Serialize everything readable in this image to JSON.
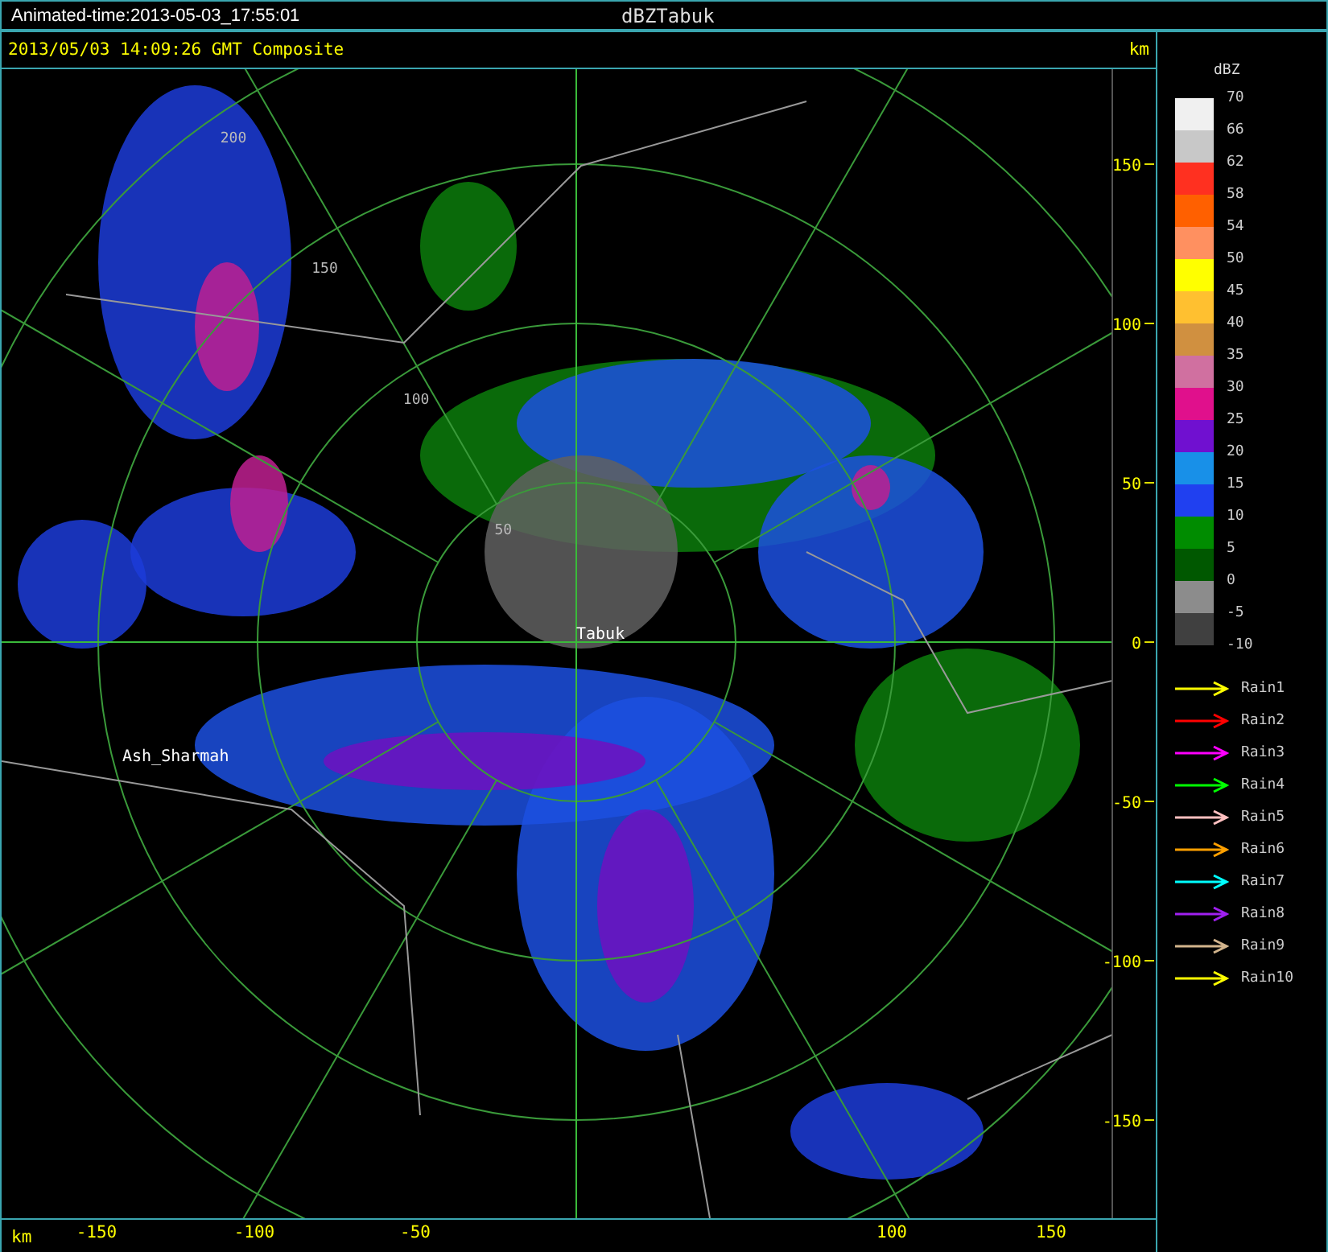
{
  "title_bar": {
    "animated_time": "Animated-time:2013-05-03_17:55:01",
    "title": "dBZTabuk"
  },
  "header": {
    "caption": "2013/05/03 14:09:26 GMT Composite",
    "unit": "km"
  },
  "map": {
    "ring_labels": [
      "50",
      "100",
      "150",
      "200"
    ],
    "places": [
      {
        "name": "Tabuk"
      },
      {
        "name": "Ash_Sharmah"
      }
    ]
  },
  "y_axis": {
    "ticks": [
      "150",
      "100",
      "50",
      "0",
      "-50",
      "-100",
      "-150"
    ]
  },
  "x_axis": {
    "unit": "km",
    "ticks": [
      "-150",
      "-100",
      "-50",
      "100",
      "150"
    ]
  },
  "legend": {
    "title": "dBZ",
    "scale": [
      {
        "label": "70",
        "color": "#f0f0f0"
      },
      {
        "label": "66",
        "color": "#c8c8c8"
      },
      {
        "label": "62",
        "color": "#ff3020"
      },
      {
        "label": "58",
        "color": "#ff6000"
      },
      {
        "label": "54",
        "color": "#ff9060"
      },
      {
        "label": "50",
        "color": "#ffff00"
      },
      {
        "label": "45",
        "color": "#ffc030"
      },
      {
        "label": "40",
        "color": "#d09040"
      },
      {
        "label": "35",
        "color": "#d070a0"
      },
      {
        "label": "30",
        "color": "#e0108c"
      },
      {
        "label": "25",
        "color": "#7010d0"
      },
      {
        "label": "20",
        "color": "#1890e8"
      },
      {
        "label": "15",
        "color": "#2040f0"
      },
      {
        "label": "10",
        "color": "#008c00"
      },
      {
        "label": "5",
        "color": "#005800"
      },
      {
        "label": "0",
        "color": "#8c8c8c"
      },
      {
        "label": "-5",
        "color": "#404040"
      },
      {
        "label": "-10"
      }
    ],
    "tracks": [
      {
        "label": "Rain1",
        "color": "#ffff00"
      },
      {
        "label": "Rain2",
        "color": "#ff0000"
      },
      {
        "label": "Rain3",
        "color": "#ff00ff"
      },
      {
        "label": "Rain4",
        "color": "#00ff00"
      },
      {
        "label": "Rain5",
        "color": "#ffc0c0"
      },
      {
        "label": "Rain6",
        "color": "#ffa000"
      },
      {
        "label": "Rain7",
        "color": "#00ffff"
      },
      {
        "label": "Rain8",
        "color": "#a020f0"
      },
      {
        "label": "Rain9",
        "color": "#d2b48c"
      },
      {
        "label": "Rain10",
        "color": "#ffff00"
      }
    ]
  }
}
